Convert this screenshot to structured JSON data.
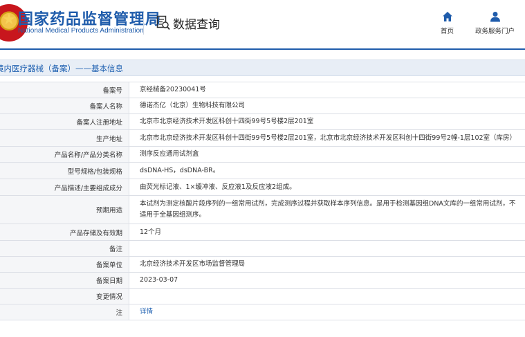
{
  "header": {
    "logo_cn": "国家药品监督管理局",
    "logo_en": "National Medical Products Administration",
    "query_title": "数据查询",
    "nav": [
      {
        "label": "首页",
        "icon": "home-icon"
      },
      {
        "label": "政务服务门户",
        "icon": "user-icon"
      }
    ]
  },
  "page_title": "境内医疗器械（备案）——基本信息",
  "rows": [
    {
      "label": "备案号",
      "value": "京经械备20230041号"
    },
    {
      "label": "备案人名称",
      "value": "德诺杰亿（北京）生物科技有限公司"
    },
    {
      "label": "备案人注册地址",
      "value": "北京市北京经济技术开发区科创十四街99号5号楼2层201室"
    },
    {
      "label": "生产地址",
      "value": "北京市北京经济技术开发区科创十四街99号5号楼2层201室，北京市北京经济技术开发区科创十四街99号2幢-1层102室（库房）"
    },
    {
      "label": "产品名称/产品分类名称",
      "value": "测序反应通用试剂盒"
    },
    {
      "label": "型号规格/包装规格",
      "value": "dsDNA-HS，dsDNA-BR。"
    },
    {
      "label": "产品描述/主要组成成分",
      "value": "由荧光标记液、1×缓冲液、反应液1及反应液2组成。"
    },
    {
      "label": "预期用途",
      "value": "本试剂为测定核酸片段序列的一组常用试剂，完成测序过程并获取样本序列信息。是用于检测基因组DNA文库的一组常用试剂，不适用于全基因组测序。"
    },
    {
      "label": "产品存储及有效期",
      "value": "12个月"
    },
    {
      "label": "备注",
      "value": ""
    },
    {
      "label": "备案单位",
      "value": "北京经济技术开发区市场监督管理局"
    },
    {
      "label": "备案日期",
      "value": "2023-03-07"
    },
    {
      "label": "变更情况",
      "value": ""
    },
    {
      "label": "注",
      "value": "详情"
    }
  ],
  "colors": {
    "brand_blue": "#1f5cab",
    "link_blue": "#1d5fb0",
    "label_bg": "#f5f6f8",
    "titlebar_bg": "#e8eef6"
  }
}
